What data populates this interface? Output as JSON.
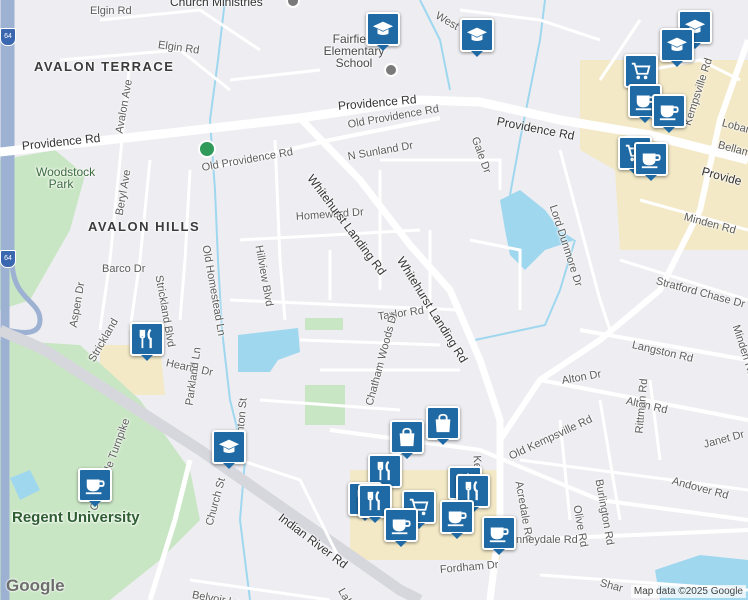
{
  "map": {
    "logo": "Google",
    "attribution": "Map data ©2025 Google",
    "colors": {
      "land": "#eeeef2",
      "road": "#ffffff",
      "highway": "#9db1d3",
      "park": "#c9e6c4",
      "water": "#9fd7ef",
      "commercial": "#f3e9c6",
      "poi": "#1f6aa5"
    }
  },
  "labels": {
    "church_ministries": "Church Ministries",
    "elgin": "Elgin Rd",
    "west": "West",
    "avalon_terrace": "AVALON TERRACE",
    "avalon_ave": "Avalon Ave",
    "fairfield_school": "Fairfield Elementary School",
    "providence_w": "Providence Rd",
    "providence_mid": "Providence Rd",
    "providence_e": "Providence Rd",
    "providence_far": "Provide",
    "old_providence_ne": "Old Providence Rd",
    "old_providence_sw": "Old Providence Rd",
    "gale": "Gale Dr",
    "lord_dunmore": "Lord Dunmore Dr",
    "kempsville_n": "Kempsville Rd",
    "kempsville_s": "Kempsville",
    "lobar": "Lobar",
    "bellamy": "Bellamy",
    "minden_n": "Minden Rd",
    "minden_s": "Minden Rd",
    "n_sunland": "N Sunland Dr",
    "woodstock_park": "Woodstock Park",
    "beryl": "Beryl Ave",
    "avalon_hills": "AVALON HILLS",
    "barco": "Barco Dr",
    "old_homestead": "Old Homestead Ln",
    "hillview": "Hillview Blvd",
    "homeward": "Homeward Dr",
    "whitehurst_1": "Whitehurst Landing Rd",
    "whitehurst_2": "Whitehurst Landing Rd",
    "strickland_blvd": "Strickland Blvd",
    "stratford": "Stratford Chase Dr",
    "aspen": "Aspen Dr",
    "strickland": "Strickland",
    "hearth": "Hearth Dr",
    "taylor": "Taylor Rd",
    "langston": "Langston Rd",
    "parkland": "Parkland Ln",
    "nam_woods": "Chatham Woods Dr",
    "alton_1": "Alton Dr",
    "alton_2": "Alton Rd",
    "rittman": "Rittman Rd",
    "janet": "Janet Dr",
    "old_kempsville": "Old Kempsville Rd",
    "andover": "Andover Rd",
    "acredale": "Acredale Rd",
    "olive": "Olive Rd",
    "burlington": "Burlington Rd",
    "centerville": "Centerville Turnpike",
    "fenton": "Fenton St",
    "church_st": "Church St",
    "indian_river": "Indian River Rd",
    "regent": "Regent University",
    "fordham": "Fordham Dr",
    "kenneydale": "nneydale Rd",
    "belvoir": "Belvoir Ln",
    "lake": "Lake",
    "shar": "Shar",
    "route": "64"
  },
  "pois": [
    {
      "icon": "school-icon"
    },
    {
      "icon": "school-icon"
    },
    {
      "icon": "school-icon"
    },
    {
      "icon": "school-icon"
    },
    {
      "icon": "school-icon"
    },
    {
      "icon": "grocery-cart-icon"
    },
    {
      "icon": "cafe-icon"
    },
    {
      "icon": "cafe-icon"
    },
    {
      "icon": "grocery-cart-icon"
    },
    {
      "icon": "cafe-icon"
    },
    {
      "icon": "restaurant-icon"
    },
    {
      "icon": "cafe-icon"
    },
    {
      "icon": "school-icon"
    },
    {
      "icon": "shopping-bag-icon"
    },
    {
      "icon": "shopping-bag-icon"
    },
    {
      "icon": "restaurant-icon"
    },
    {
      "icon": "restaurant-icon"
    },
    {
      "icon": "restaurant-icon"
    },
    {
      "icon": "restaurant-icon"
    },
    {
      "icon": "restaurant-icon"
    },
    {
      "icon": "grocery-cart-icon"
    },
    {
      "icon": "cafe-icon"
    },
    {
      "icon": "cafe-icon"
    },
    {
      "icon": "cafe-icon"
    }
  ]
}
